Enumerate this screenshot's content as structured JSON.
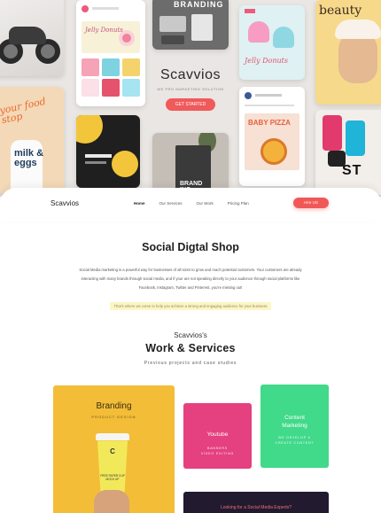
{
  "hero": {
    "brand_label": "BRANDING",
    "logo_title": "Scavvios",
    "logo_subtitle": "WE PRO MARKETING SOLUTION",
    "logo_button": "GET STARTED",
    "food_tile_text": "your food stop",
    "milk_text": "milk & eggs",
    "insta_tile_text": "Jelly Donuts",
    "cupcake_tile_text": "Jelly Donuts",
    "pizza_text": "BABY PIZZA",
    "beauty_text": "beauty",
    "st_text": "ST",
    "bottle_box_text": "BRAND ING"
  },
  "nav": {
    "logo": "Scavvios",
    "links": [
      "Home",
      "Our Services",
      "Our Work",
      "Pricing Plan"
    ],
    "cta": "Hire US"
  },
  "intro": {
    "title": "Social Digtal Shop",
    "body": "Social Media marketing is a powerful way for businesses of all sizes to grow and reach potential customers. Your customers are already interacting with many brands through social media, and if your are not speaking directly to your audience through social platforms like Facebook, Instagram, Twitter and Pinterest, you're missing out!",
    "highlight": "That's where we come to help you achieve a strong and engaging audience for your business"
  },
  "work": {
    "pretitle": "Scavvios's",
    "title": "Work & Services",
    "subtitle": "Previous projects and case studies",
    "cards": {
      "branding": {
        "title": "Branding",
        "subtitle": "PRODUCT DESIGN",
        "cup_text": "FREE PAPER CUP MOCK UP"
      },
      "youtube": {
        "title": "Youtube",
        "subtitle_1": "BANNERS",
        "subtitle_2": "VIDEO EDITING"
      },
      "content": {
        "title_1": "Content",
        "title_2": "Marketing",
        "subtitle_1": "WE DEVELOP &",
        "subtitle_2": "CREATE CONTENT"
      },
      "dark": {
        "title": "Looking for a Social Media Experts?"
      }
    }
  },
  "colors": {
    "accent": "#f25757",
    "branding_card": "#f3bd37",
    "youtube_card": "#e5407f",
    "content_card": "#41d98a",
    "dark_card": "#221a2e"
  }
}
